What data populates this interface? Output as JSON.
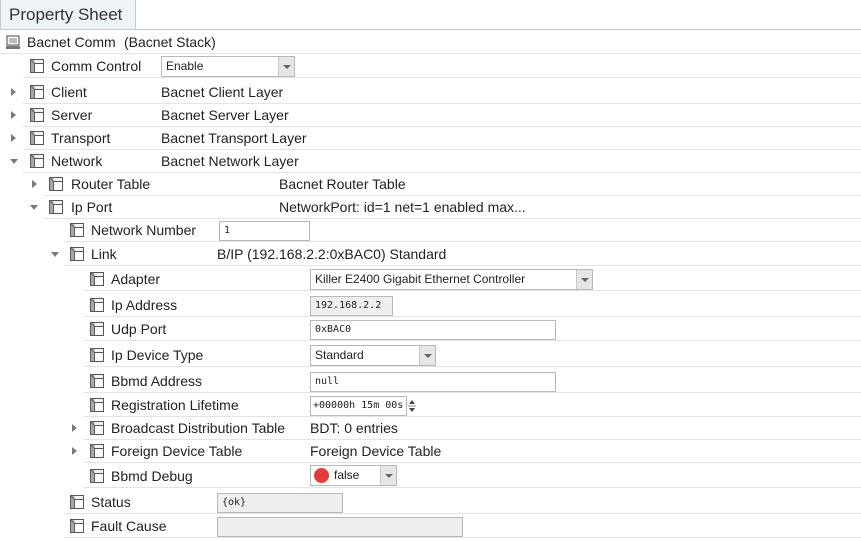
{
  "tab": {
    "label": "Property Sheet"
  },
  "root": {
    "label": "Bacnet Comm",
    "value": "(Bacnet Stack)"
  },
  "comm_control": {
    "label": "Comm Control",
    "value": "Enable"
  },
  "client": {
    "label": "Client",
    "value": "Bacnet Client Layer"
  },
  "server": {
    "label": "Server",
    "value": "Bacnet Server Layer"
  },
  "transport": {
    "label": "Transport",
    "value": "Bacnet Transport Layer"
  },
  "network": {
    "label": "Network",
    "value": "Bacnet Network Layer"
  },
  "router_table": {
    "label": "Router Table",
    "value": "Bacnet Router Table"
  },
  "ip_port": {
    "label": "Ip Port",
    "value": "NetworkPort: id=1 net=1 enabled max..."
  },
  "network_number": {
    "label": "Network Number",
    "value": "1"
  },
  "link": {
    "label": "Link",
    "value": "B/IP (192.168.2.2:0xBAC0) Standard"
  },
  "adapter": {
    "label": "Adapter",
    "value": "Killer E2400 Gigabit Ethernet Controller"
  },
  "ip_address": {
    "label": "Ip Address",
    "value": "192.168.2.2"
  },
  "udp_port": {
    "label": "Udp Port",
    "value": "0xBAC0"
  },
  "ip_device_type": {
    "label": "Ip Device Type",
    "value": "Standard"
  },
  "bbmd_address": {
    "label": "Bbmd Address",
    "value": "null"
  },
  "registration_lifetime": {
    "label": "Registration Lifetime",
    "value": "+00000h 15m 00s"
  },
  "bdt": {
    "label": "Broadcast Distribution Table",
    "value": "BDT: 0 entries"
  },
  "fdt": {
    "label": "Foreign Device Table",
    "value": "Foreign Device Table"
  },
  "bbmd_debug": {
    "label": "Bbmd Debug",
    "value": "false"
  },
  "status": {
    "label": "Status",
    "value": "{ok}"
  },
  "fault_cause": {
    "label": "Fault Cause",
    "value": ""
  },
  "icons": {
    "root": "stack-icon",
    "property": "cube-icon",
    "collapsed": "triangle-right-icon",
    "expanded": "triangle-down-icon",
    "bool_false": "red-circle-icon"
  },
  "colors": {
    "tab_bg": "#eef3f8",
    "readonly_bg": "#efefef",
    "false_dot": "#e23c3c"
  }
}
